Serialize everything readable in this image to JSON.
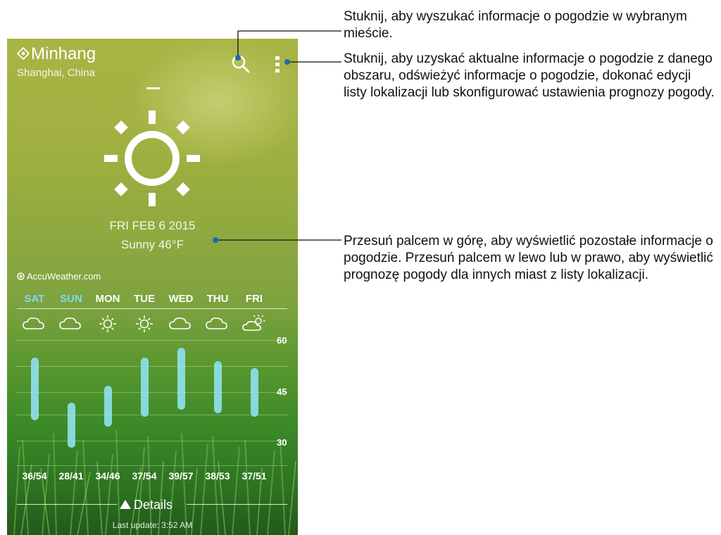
{
  "location": {
    "name": "Minhang",
    "region": "Shanghai, China"
  },
  "header_icons": {
    "search": "search-icon",
    "menu": "more-vertical-icon",
    "location": "location-pin-icon"
  },
  "current": {
    "date": "FRI FEB 6 2015",
    "condition": "Sunny 46°F",
    "icon": "sun-icon"
  },
  "provider": "AccuWeather.com",
  "forecast": {
    "days": [
      {
        "label": "SAT",
        "highlight": true,
        "icon": "cloud-icon",
        "low": 36,
        "high": 54,
        "range": "36/54"
      },
      {
        "label": "SUN",
        "highlight": true,
        "icon": "cloud-icon",
        "low": 28,
        "high": 41,
        "range": "28/41"
      },
      {
        "label": "MON",
        "highlight": false,
        "icon": "sun-icon",
        "low": 34,
        "high": 46,
        "range": "34/46"
      },
      {
        "label": "TUE",
        "highlight": false,
        "icon": "sun-icon",
        "low": 37,
        "high": 54,
        "range": "37/54"
      },
      {
        "label": "WED",
        "highlight": false,
        "icon": "cloud-icon",
        "low": 39,
        "high": 57,
        "range": "39/57"
      },
      {
        "label": "THU",
        "highlight": false,
        "icon": "cloud-icon",
        "low": 38,
        "high": 53,
        "range": "38/53"
      },
      {
        "label": "FRI",
        "highlight": false,
        "icon": "partly-cloudy-icon",
        "low": 37,
        "high": 51,
        "range": "37/51"
      }
    ],
    "axis_ticks": [
      "60",
      "45",
      "30"
    ]
  },
  "details_label": "Details",
  "last_update": "Last update: 3:52 AM",
  "callouts": {
    "search": "Stuknij, aby wyszukać informacje o pogodzie w wybranym mieście.",
    "menu": "Stuknij, aby uzyskać aktualne informacje o pogodzie z danego obszaru, odświeżyć informacje o pogodzie, dokonać edycji listy lokalizacji lub skonfigurować ustawienia prognozy pogody.",
    "swipe": "Przesuń palcem w górę, aby wyświetlić pozostałe informacje o pogodzie. Przesuń palcem w lewo lub w prawo, aby wyświetlić prognozę pogody dla innych miast z listy lokalizacji."
  },
  "colors": {
    "accent_day": "#7fd8ee",
    "bar": "#8ee0ec",
    "callout_line": "#1a6bb0"
  }
}
